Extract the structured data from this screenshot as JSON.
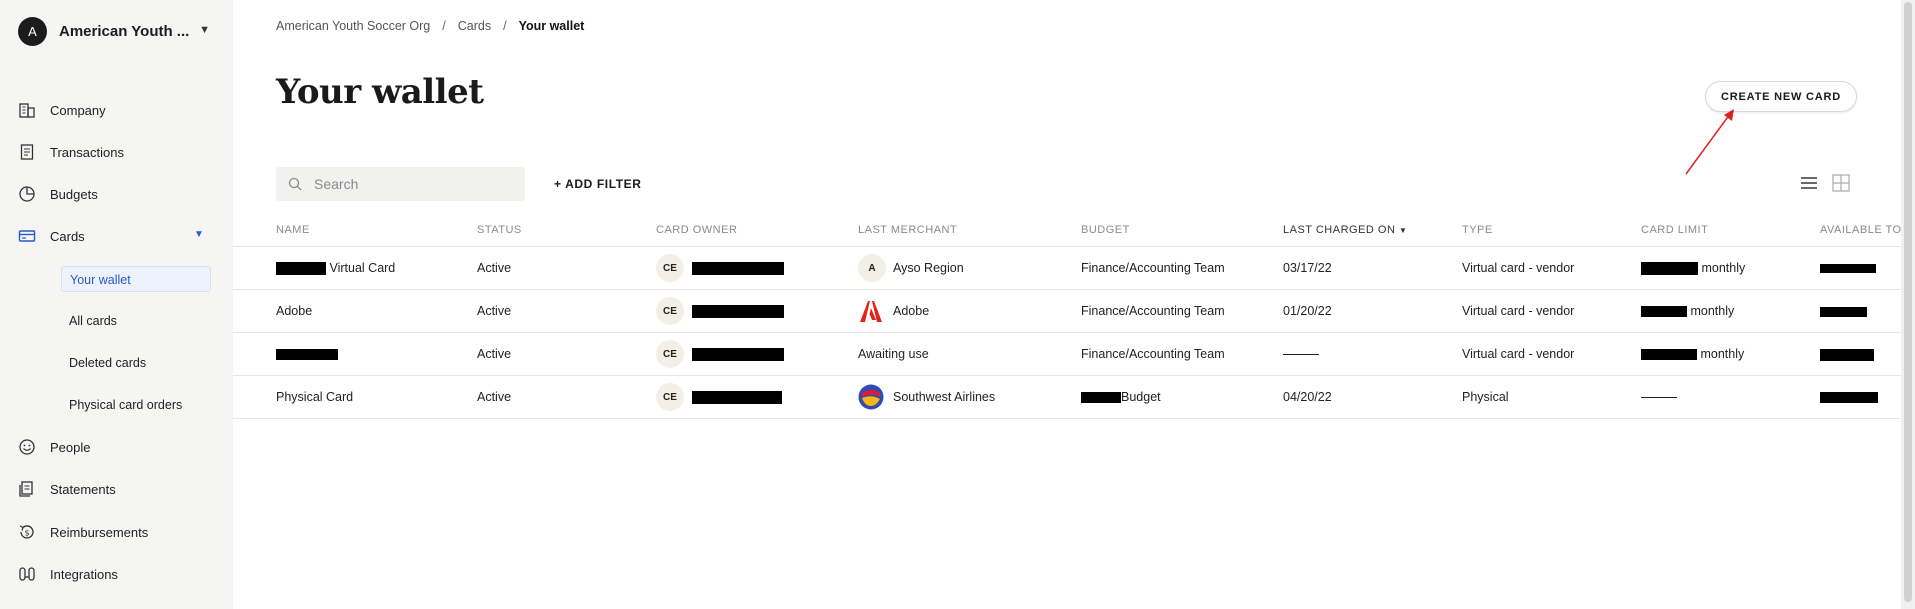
{
  "org": {
    "initial": "A",
    "name": "American Youth ..."
  },
  "nav": {
    "company": "Company",
    "transactions": "Transactions",
    "budgets": "Budgets",
    "cards": "Cards",
    "cards_sub": [
      "Your wallet",
      "All cards",
      "Deleted cards",
      "Physical card orders"
    ],
    "people": "People",
    "statements": "Statements",
    "reimbursements": "Reimbursements",
    "integrations": "Integrations"
  },
  "breadcrumb": [
    "American Youth Soccer Org",
    "Cards",
    "Your wallet"
  ],
  "page_title": "Your wallet",
  "create_button": "CREATE NEW CARD",
  "search": {
    "placeholder": "Search"
  },
  "add_filter": "+ ADD FILTER",
  "table": {
    "headers": [
      "NAME",
      "STATUS",
      "CARD OWNER",
      "LAST MERCHANT",
      "BUDGET",
      "LAST CHARGED ON",
      "TYPE",
      "CARD LIMIT",
      "AVAILABLE TO"
    ],
    "sorted_column": "LAST CHARGED ON",
    "rows": [
      {
        "name": "Virtual Card",
        "status": "Active",
        "owner_initials": "CE",
        "merchant_initial": "A",
        "merchant": "Ayso Region",
        "budget": "Finance/Accounting Team",
        "last_charged": "03/17/22",
        "type": "Virtual card - vendor",
        "limit_suffix": "monthly"
      },
      {
        "name": "Adobe",
        "status": "Active",
        "owner_initials": "CE",
        "merchant": "Adobe",
        "budget": "Finance/Accounting Team",
        "last_charged": "01/20/22",
        "type": "Virtual card - vendor",
        "limit_suffix": "monthly"
      },
      {
        "name": "",
        "status": "Active",
        "owner_initials": "CE",
        "merchant": "Awaiting use",
        "budget": "Finance/Accounting Team",
        "last_charged": "",
        "type": "Virtual card - vendor",
        "limit_suffix": "monthly"
      },
      {
        "name": "Physical Card",
        "status": "Active",
        "owner_initials": "CE",
        "merchant": "Southwest Airlines",
        "budget": "Budget",
        "last_charged": "04/20/22",
        "type": "Physical",
        "limit_suffix": ""
      }
    ]
  },
  "colors": {
    "accent": "#2a58c9",
    "sidebar_bg": "#f5f5f4",
    "arrow": "#e02020"
  }
}
